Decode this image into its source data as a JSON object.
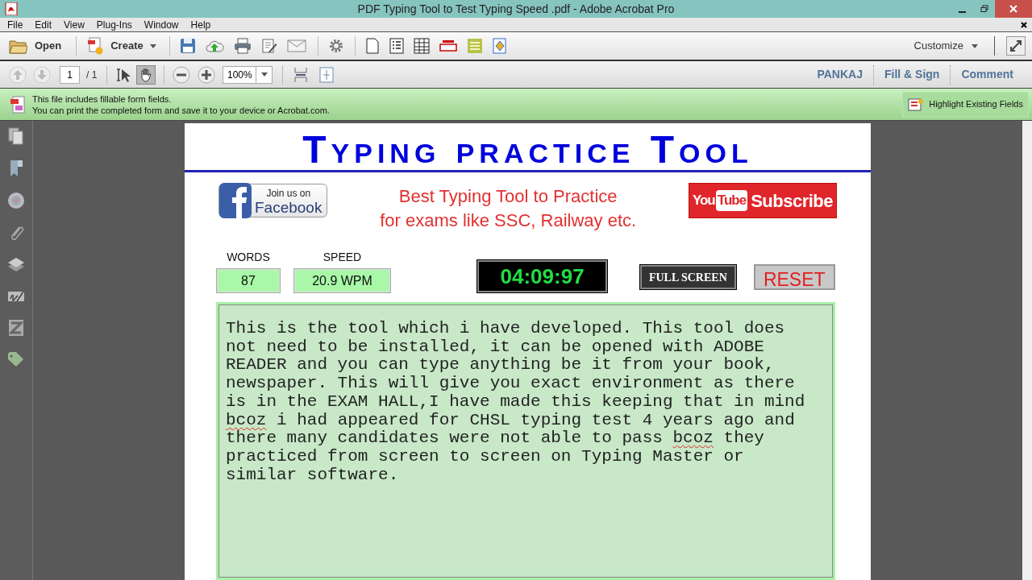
{
  "window": {
    "title": "PDF Typing Tool to Test Typing Speed .pdf - Adobe Acrobat Pro"
  },
  "menu": [
    "File",
    "Edit",
    "View",
    "Plug-Ins",
    "Window",
    "Help"
  ],
  "toolbar": {
    "open": "Open",
    "create": "Create",
    "customize": "Customize"
  },
  "nav": {
    "page": "1",
    "pages": "/ 1",
    "zoom": "100%",
    "links": [
      "PANKAJ",
      "Fill & Sign",
      "Comment"
    ]
  },
  "notice": {
    "lines": [
      "This file includes fillable form fields.",
      "You can print the completed form and save it to your device or Acrobat.com."
    ],
    "button": "Highlight Existing Fields"
  },
  "page": {
    "title": "Typing practice Tool",
    "facebook": {
      "top": "Join us on",
      "bottom": "Facebook"
    },
    "tagline": [
      "Best Typing Tool to Practice",
      "for exams like SSC, Railway etc."
    ],
    "youtube": {
      "you": "You",
      "tube": "Tube",
      "subscribe": "Subscribe"
    },
    "stats": [
      {
        "label": "WORDS",
        "value": "87"
      },
      {
        "label": "SPEED",
        "value": "20.9 WPM"
      }
    ],
    "timer": "04:09:97",
    "full_screen": "FULL SCREEN",
    "reset": "RESET",
    "typed": [
      {
        "text": "This is the tool which i have developed. This tool does not need to be installed, it can be opened with ADOBE READER and you can type anything be it from your book, newspaper. This will give you exact environment as there is in the EXAM HALL,I have made this keeping that in mind ",
        "misspelled": false
      },
      {
        "text": "bcoz",
        "misspelled": true
      },
      {
        "text": " i had appeared for CHSL typing test 4 years ago and there many candidates were not able to pass ",
        "misspelled": false
      },
      {
        "text": "bcoz",
        "misspelled": true
      },
      {
        "text": " they practiced from screen to screen on Typing Master or similar software.",
        "misspelled": false
      }
    ]
  }
}
